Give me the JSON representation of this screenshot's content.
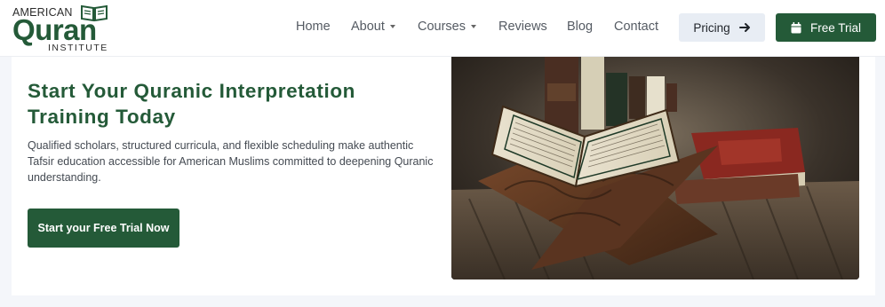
{
  "logo": {
    "top_text": "AMERICAN",
    "main_text": "Quran",
    "sub_text": "INSTITUTE",
    "icon": "open-book-icon",
    "brand_color": "#245a38"
  },
  "nav": {
    "items": [
      {
        "label": "Home"
      },
      {
        "label": "About",
        "has_dropdown": true
      },
      {
        "label": "Courses",
        "has_dropdown": true
      },
      {
        "label": "Reviews"
      },
      {
        "label": "Blog"
      },
      {
        "label": "Contact"
      }
    ]
  },
  "header_buttons": {
    "pricing_label": "Pricing",
    "pricing_icon": "arrow-right-icon",
    "trial_label": "Free Trial",
    "trial_icon": "calendar-icon"
  },
  "hero": {
    "title": "Start Your Quranic Interpretation Training Today",
    "description": "Qualified scholars, structured curricula, and flexible scheduling make authentic Tafsir education accessible for American Muslims committed to deepening Quranic understanding.",
    "cta_label": "Start your Free Trial Now",
    "image_subject": "open-quran-on-wooden-stand-photo"
  }
}
